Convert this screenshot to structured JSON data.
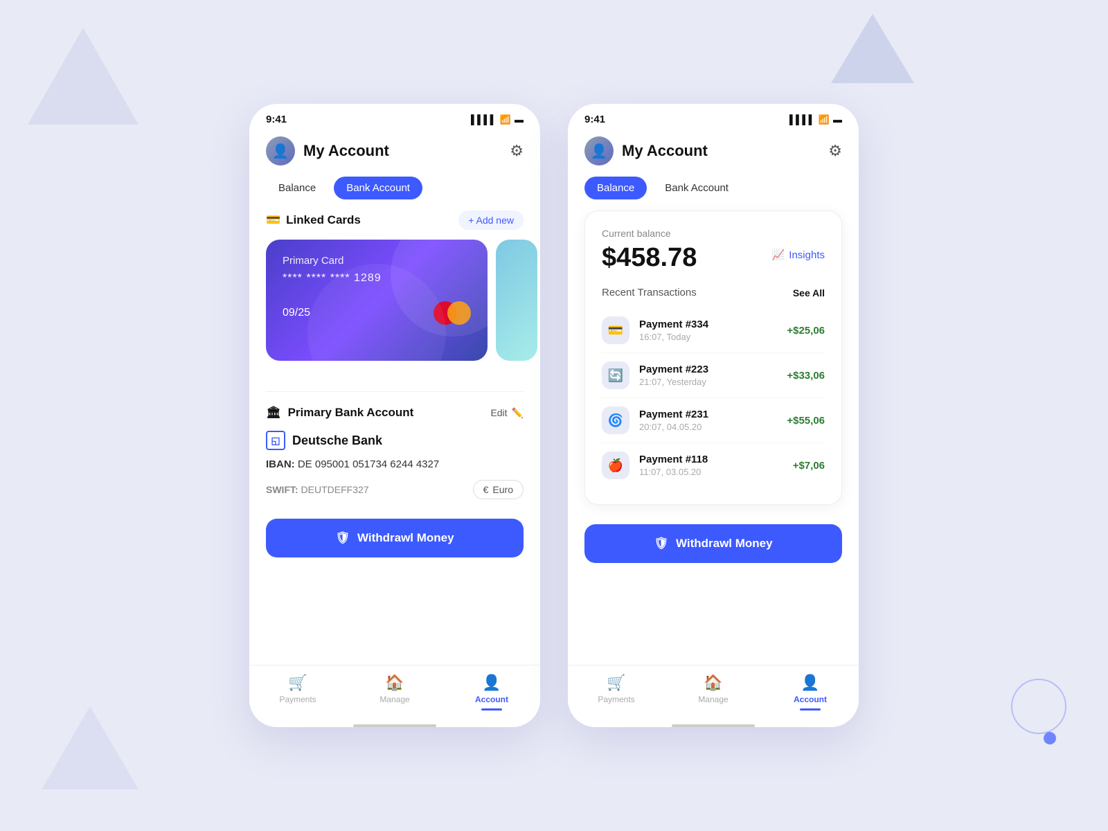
{
  "phone1": {
    "statusBar": {
      "time": "9:41",
      "signal": "▌▌▌▌",
      "wifi": "WiFi",
      "battery": "🔋"
    },
    "header": {
      "title": "My Account",
      "gearLabel": "⚙"
    },
    "tabs": {
      "balance": "Balance",
      "bankAccount": "Bank Account",
      "activeTab": "bankAccount"
    },
    "linkedCards": {
      "sectionTitle": "Linked Cards",
      "addNewLabel": "+ Add new",
      "cardLabel": "Primary Card",
      "cardNumber": "**** **** **** 1289",
      "cardExpiry": "09/25",
      "cardBrand": "mastercard",
      "dots": [
        true,
        false,
        false
      ]
    },
    "bankAccount": {
      "sectionTitle": "Primary Bank Account",
      "editLabel": "Edit",
      "bankName": "Deutsche Bank",
      "ibanLabel": "IBAN:",
      "ibanValue": "DE 095001 051734 6244 4327",
      "swiftLabel": "SWIFT:",
      "swiftValue": "DEUTDEFF327",
      "currency": "Euro"
    },
    "withdrawButton": "Withdrawl Money",
    "bottomNav": {
      "payments": "Payments",
      "manage": "Manage",
      "account": "Account",
      "activeTab": "account"
    }
  },
  "phone2": {
    "statusBar": {
      "time": "9:41"
    },
    "header": {
      "title": "My Account",
      "gearLabel": "⚙"
    },
    "tabs": {
      "balance": "Balance",
      "bankAccount": "Bank Account",
      "activeTab": "balance"
    },
    "balance": {
      "label": "Current balance",
      "amount": "$458.78",
      "insightsLabel": "Insights"
    },
    "transactions": {
      "title": "Recent Transactions",
      "seeAll": "See All",
      "items": [
        {
          "id": "Payment #334",
          "time": "16:07, Today",
          "amount": "+$25,06",
          "icon": "💳"
        },
        {
          "id": "Payment #223",
          "time": "21:07, Yesterday",
          "amount": "+$33,06",
          "icon": "🔄"
        },
        {
          "id": "Payment #231",
          "time": "20:07, 04.05.20",
          "amount": "+$55,06",
          "icon": "🌀"
        },
        {
          "id": "Payment #118",
          "time": "11:07, 03.05.20",
          "amount": "+$7,06",
          "icon": "🍎"
        }
      ]
    },
    "withdrawButton": "Withdrawl Money",
    "bottomNav": {
      "payments": "Payments",
      "manage": "Manage",
      "account": "Account",
      "activeTab": "account"
    }
  }
}
